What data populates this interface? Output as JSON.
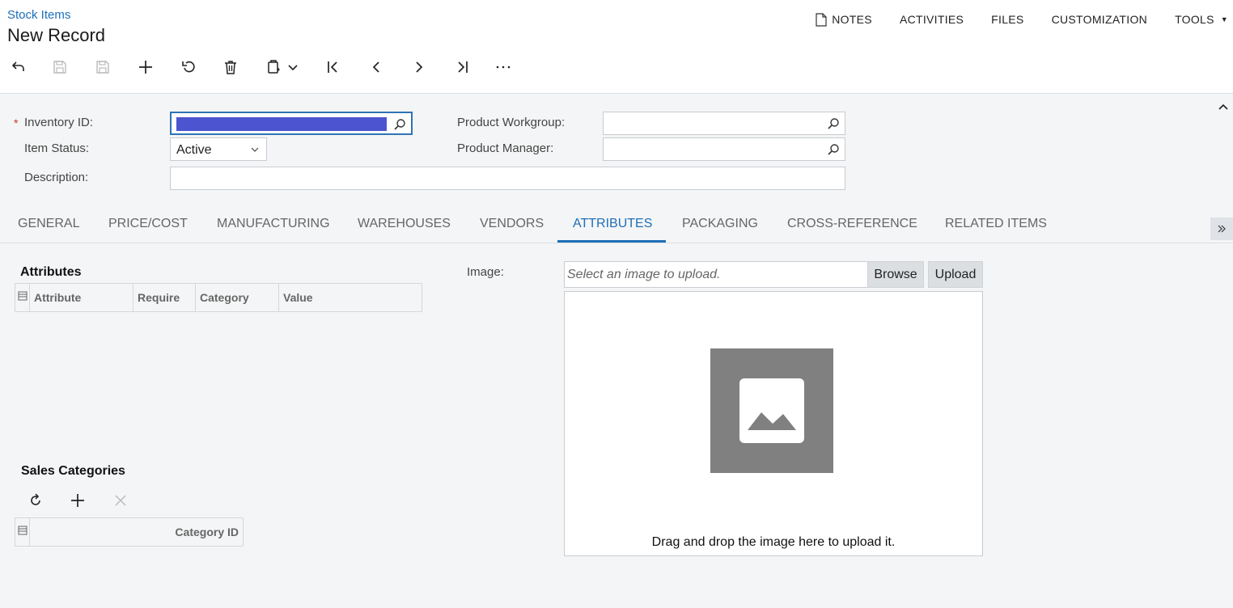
{
  "header": {
    "breadcrumb": "Stock Items",
    "title": "New Record",
    "menu": {
      "notes": "NOTES",
      "activities": "ACTIVITIES",
      "files": "FILES",
      "customization": "CUSTOMIZATION",
      "tools": "TOOLS"
    }
  },
  "toolbar": {
    "icons": [
      "back-icon",
      "save-close-icon",
      "save-icon",
      "add-icon",
      "undo-icon",
      "delete-icon",
      "copy-paste-icon",
      "first-icon",
      "previous-icon",
      "next-icon",
      "last-icon",
      "more-icon"
    ]
  },
  "form": {
    "inventory_id_label": "Inventory ID:",
    "required_mark": "*",
    "item_status_label": "Item Status:",
    "item_status_value": "Active",
    "description_label": "Description:",
    "description_value": "",
    "product_workgroup_label": "Product Workgroup:",
    "product_workgroup_value": "",
    "product_manager_label": "Product Manager:",
    "product_manager_value": ""
  },
  "tabs": [
    {
      "label": "GENERAL",
      "active": false
    },
    {
      "label": "PRICE/COST",
      "active": false
    },
    {
      "label": "MANUFACTURING",
      "active": false
    },
    {
      "label": "WAREHOUSES",
      "active": false
    },
    {
      "label": "VENDORS",
      "active": false
    },
    {
      "label": "ATTRIBUTES",
      "active": true
    },
    {
      "label": "PACKAGING",
      "active": false
    },
    {
      "label": "CROSS-REFERENCE",
      "active": false
    },
    {
      "label": "RELATED ITEMS",
      "active": false
    }
  ],
  "attributes": {
    "title": "Attributes",
    "columns": [
      "Attribute",
      "Require",
      "Category",
      "Value"
    ],
    "rows": []
  },
  "image": {
    "label": "Image:",
    "placeholder": "Select an image to upload.",
    "browse": "Browse",
    "upload": "Upload",
    "drop_text": "Drag and drop the image here to upload it."
  },
  "sales_categories": {
    "title": "Sales Categories",
    "columns": [
      "Category ID"
    ],
    "rows": []
  },
  "colors": {
    "accent": "#1d6fb8",
    "selection": "#4c55cf",
    "placeholder_image": "#808080"
  }
}
